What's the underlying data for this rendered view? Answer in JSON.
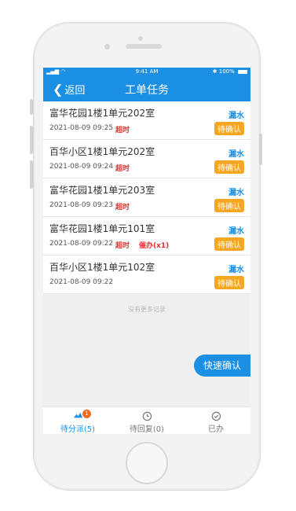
{
  "status_bar": {
    "time": "9:41 AM",
    "battery": "100%"
  },
  "header": {
    "back_label": "返回",
    "title": "工单任务"
  },
  "orders": [
    {
      "address": "富华花园1楼1单元202室",
      "type": "漏水",
      "time": "2021-08-09 09:25",
      "overdue": "超时",
      "urge": "",
      "status": "待确认"
    },
    {
      "address": "百华小区1楼1单元202室",
      "type": "漏水",
      "time": "2021-08-09 09:24",
      "overdue": "超时",
      "urge": "",
      "status": "待确认"
    },
    {
      "address": "富华花园1楼1单元203室",
      "type": "漏水",
      "time": "2021-08-09 09:23",
      "overdue": "超时",
      "urge": "",
      "status": "待确认"
    },
    {
      "address": "富华花园1楼1单元101室",
      "type": "漏水",
      "time": "2021-08-09 09:22",
      "overdue": "超时",
      "urge": "催办(x1)",
      "status": "待确认"
    },
    {
      "address": "百华小区1楼1单元102室",
      "type": "漏水",
      "time": "2021-08-09 09:22",
      "overdue": "",
      "urge": "",
      "status": "待确认"
    }
  ],
  "no_more": "没有更多记录",
  "fab_label": "快速确认",
  "tabs": [
    {
      "label": "待分派(5)",
      "badge": "1",
      "icon": "dispatch-icon",
      "active": true
    },
    {
      "label": "待回复(0)",
      "badge": "",
      "icon": "clock-icon",
      "active": false
    },
    {
      "label": "已办",
      "badge": "",
      "icon": "check-circle-icon",
      "active": false
    }
  ],
  "colors": {
    "primary": "#1b8fe4",
    "warning": "#f5a623",
    "danger": "#e23030",
    "badge": "#f26b1d"
  }
}
